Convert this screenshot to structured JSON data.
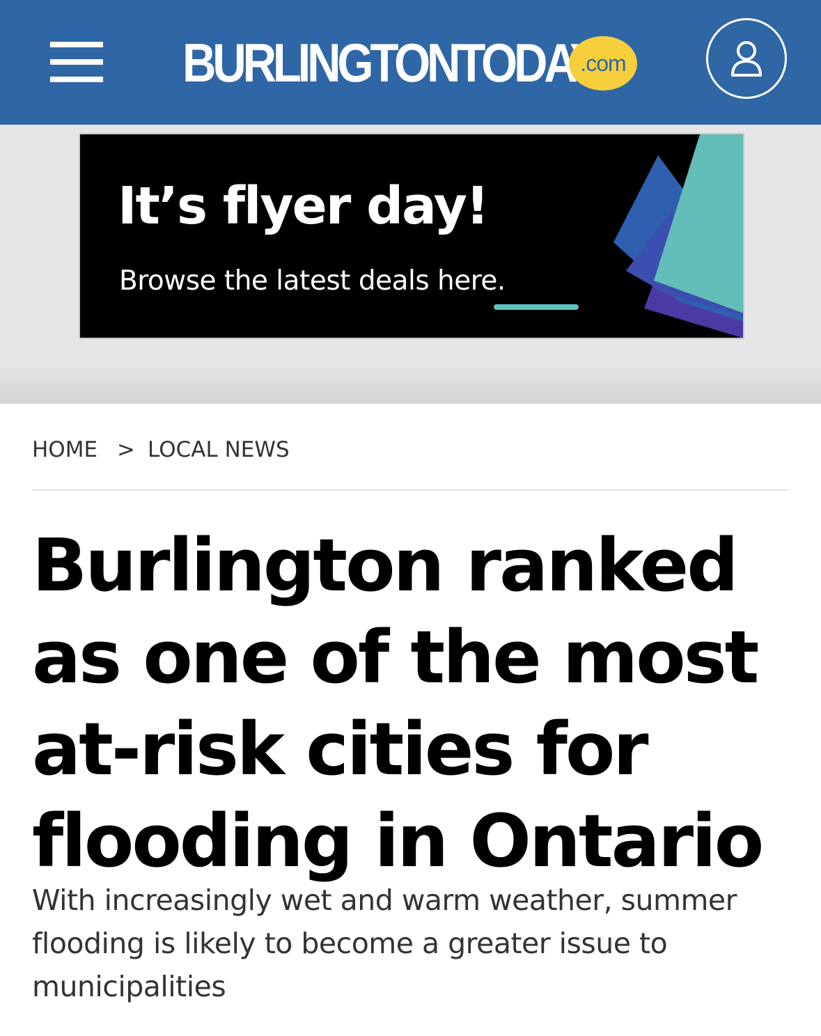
{
  "header": {
    "logo_text": "BURLINGTONTODAY",
    "logo_badge": ".com",
    "menu_icon": "hamburger-menu-icon",
    "user_icon": "user-account-icon",
    "bg_color": "#2f66a6",
    "badge_color": "#f7cf3c"
  },
  "ad": {
    "title": "It’s flyer day!",
    "subtitle": "Browse the latest deals here.",
    "accent_color": "#5ec0bd"
  },
  "breadcrumb": {
    "home": "HOME",
    "separator": ">",
    "section": "LOCAL NEWS"
  },
  "article": {
    "headline": "Burlington ranked as one of the most at-risk cities for flooding in Ontario",
    "dek": "With increasingly wet and warm weather, summer flooding is likely to become a greater issue to municipalities"
  }
}
